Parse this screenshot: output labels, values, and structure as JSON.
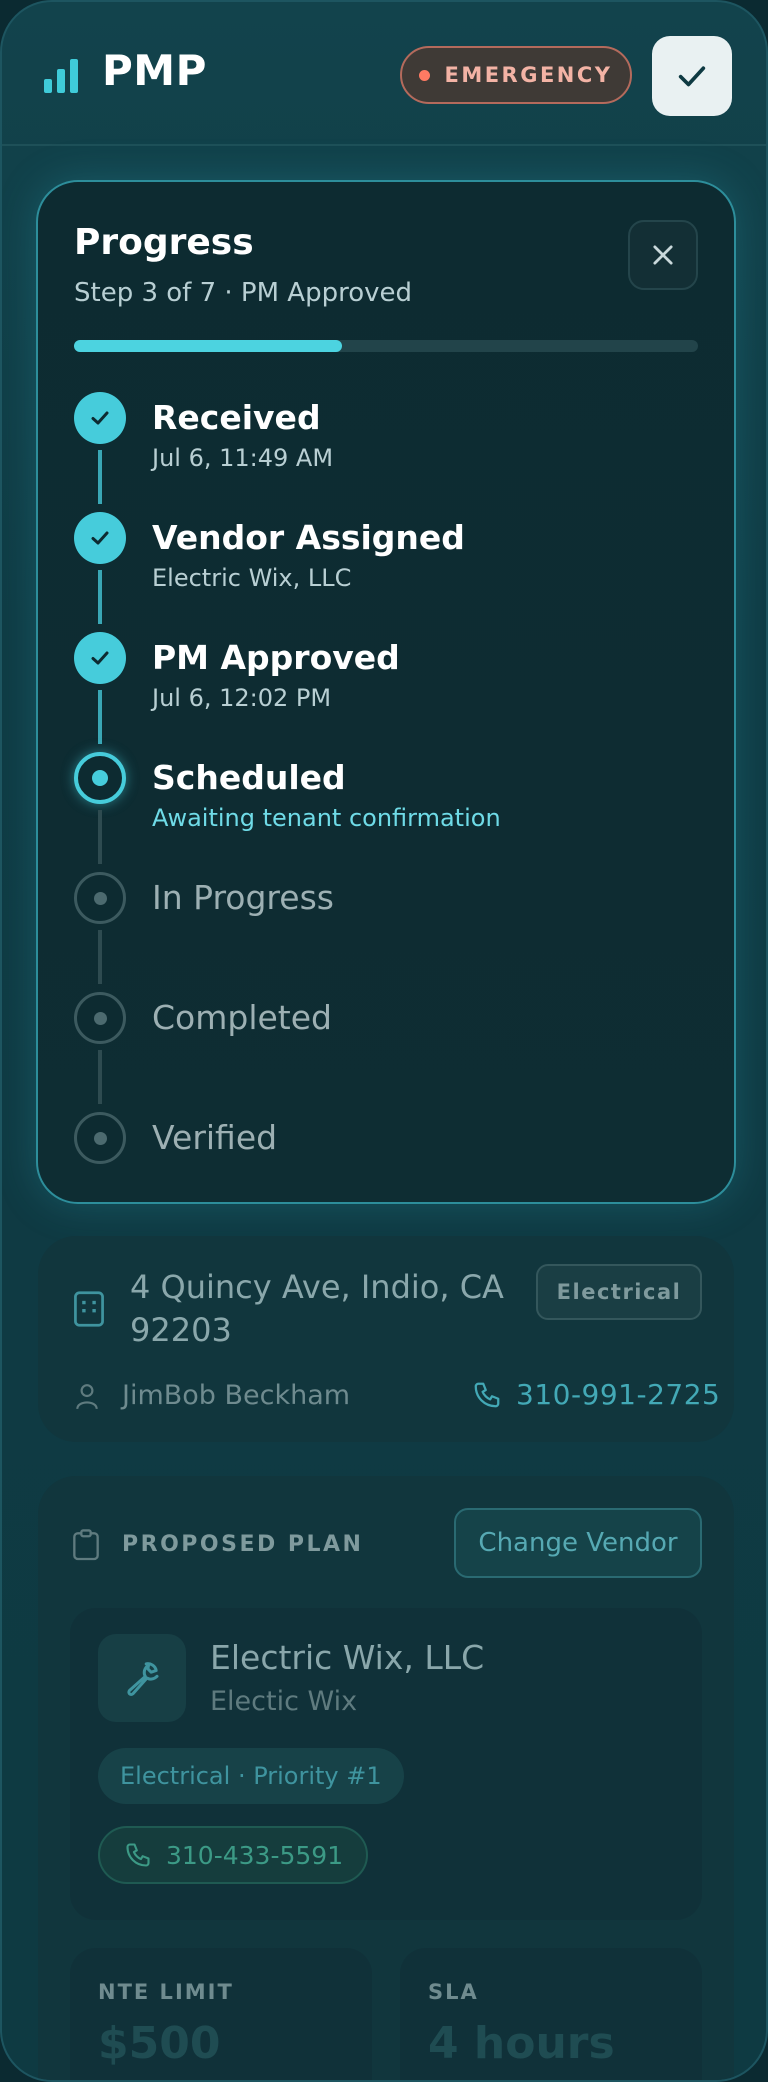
{
  "header": {
    "app_title": "PMP",
    "emergency_label": "EMERGENCY",
    "accent": "#3fcbd9",
    "emergency_color": "#ff7a63"
  },
  "progress": {
    "title": "Progress",
    "subtitle": "Step 3 of 7 · PM Approved",
    "fill_fraction": 0.43,
    "steps": [
      {
        "title": "Received",
        "detail": "Jul 6, 11:49 AM",
        "status": "done"
      },
      {
        "title": "Vendor Assigned",
        "detail": "Electric Wix, LLC",
        "status": "done"
      },
      {
        "title": "PM Approved",
        "detail": "Jul 6, 12:02 PM",
        "status": "done"
      },
      {
        "title": "Scheduled",
        "detail": "Awaiting tenant confirmation",
        "status": "current"
      },
      {
        "title": "In Progress",
        "detail": "",
        "status": "todo"
      },
      {
        "title": "Completed",
        "detail": "",
        "status": "todo"
      },
      {
        "title": "Verified",
        "detail": "",
        "status": "todo"
      }
    ]
  },
  "property": {
    "address": "4 Quincy Ave, Indio, CA 92203",
    "category": "Electrical",
    "tenant": "JimBob Beckham",
    "phone": "310-991-2725"
  },
  "plan": {
    "section_label": "PROPOSED PLAN",
    "change_vendor_label": "Change Vendor",
    "vendor_name": "Electric Wix, LLC",
    "vendor_short": "Electic Wix",
    "vendor_tag": "Electrical · Priority #1",
    "vendor_phone": "310-433-5591",
    "nte_label": "NTE LIMIT",
    "nte_value": "$500",
    "sla_label": "SLA",
    "sla_value": "4 hours"
  }
}
